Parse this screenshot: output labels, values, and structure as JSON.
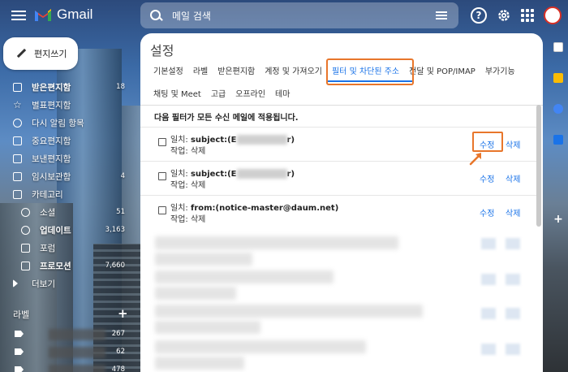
{
  "app": {
    "name": "Gmail"
  },
  "search": {
    "placeholder": "메일 검색"
  },
  "compose": {
    "label": "편지쓰기"
  },
  "sidebar": {
    "items": [
      {
        "label": "받은편지함",
        "count": "18",
        "bold": true
      },
      {
        "label": "별표편지함",
        "count": ""
      },
      {
        "label": "다시 알림 항목",
        "count": ""
      },
      {
        "label": "중요편지함",
        "count": ""
      },
      {
        "label": "보낸편지함",
        "count": ""
      },
      {
        "label": "임시보관함",
        "count": "4"
      },
      {
        "label": "카테고리",
        "count": ""
      }
    ],
    "categories": [
      {
        "label": "소셜",
        "count": "51"
      },
      {
        "label": "업데이트",
        "count": "3,163",
        "bold": true
      },
      {
        "label": "포럼",
        "count": ""
      },
      {
        "label": "프로모션",
        "count": "7,660",
        "bold": true
      }
    ],
    "more": "더보기",
    "labels_header": "라벨",
    "labels_add": "+",
    "labels": [
      {
        "count": "267"
      },
      {
        "count": "62"
      },
      {
        "count": "478"
      }
    ]
  },
  "settings": {
    "title": "설정",
    "tabs_row1": [
      "기본설정",
      "라벨",
      "받은편지함",
      "계정 및 가져오기",
      "필터 및 차단된 주소",
      "전달 및 POP/IMAP",
      "부가기능"
    ],
    "tabs_row2": [
      "채팅 및 Meet",
      "고급",
      "오프라인",
      "테마"
    ],
    "active_tab": "필터 및 차단된 주소",
    "intro": "다음 필터가 모든 수신 메일에 적용됩니다.",
    "filters": [
      {
        "match_label": "일치:",
        "match": "subject:(E",
        "match_end": "r)",
        "action": "작업: 삭제",
        "edit": "수정",
        "delete": "삭제"
      },
      {
        "match_label": "일치:",
        "match": "subject:(E",
        "match_end": "r)",
        "action": "작업: 삭제",
        "edit": "수정",
        "delete": "삭제"
      },
      {
        "match_label": "일치:",
        "match": "from:(notice-master@daum.net)",
        "match_end": "",
        "action": "작업: 삭제",
        "edit": "수정",
        "delete": "삭제"
      }
    ]
  },
  "colors": {
    "accent": "#1a73e8",
    "highlight": "#e8762b"
  }
}
